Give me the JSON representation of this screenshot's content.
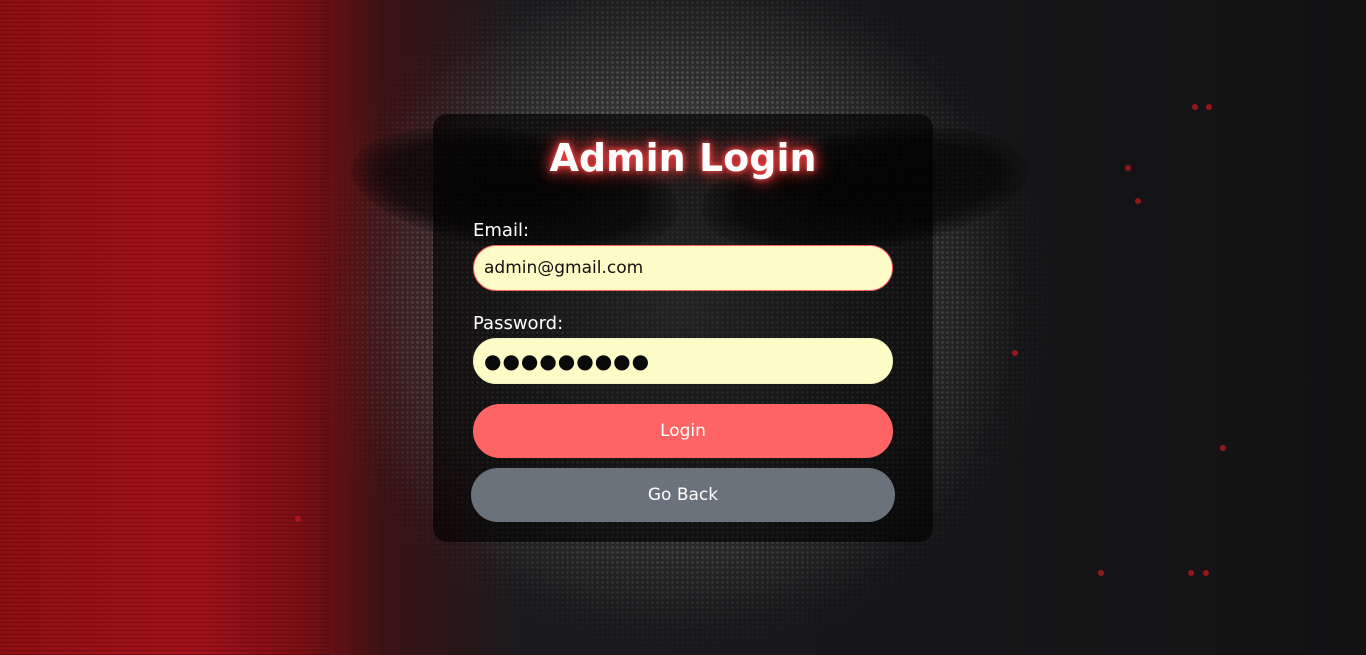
{
  "theme": {
    "card_background": "#000000",
    "title_glow": "#ff3b3b",
    "input_background": "#fefcc6",
    "login_button_color": "#ff6464",
    "back_button_color": "#6a727c"
  },
  "login_form": {
    "title": "Admin Login",
    "email_label": "Email:",
    "email_value": "admin@gmail.com",
    "password_label": "Password:",
    "password_masked": "●●●●●●●●●",
    "login_button": "Login",
    "back_button": "Go Back"
  }
}
